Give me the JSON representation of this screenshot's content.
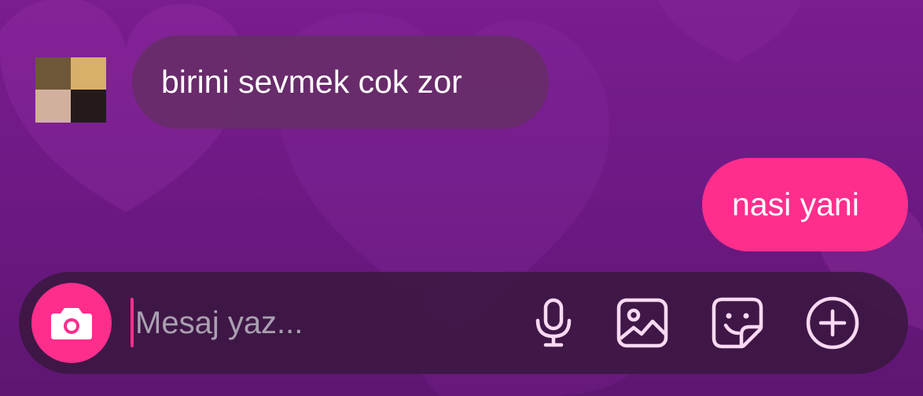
{
  "chat": {
    "messages": [
      {
        "direction": "incoming",
        "text": "birini sevmek cok zor"
      },
      {
        "direction": "outgoing",
        "text": "nasi yani"
      }
    ]
  },
  "composer": {
    "placeholder": "Mesaj yaz...",
    "value": "",
    "icons": {
      "camera": "camera-icon",
      "mic": "microphone-icon",
      "gallery": "image-gallery-icon",
      "sticker": "sticker-icon",
      "more": "plus-circle-icon"
    }
  },
  "colors": {
    "background": "#6f1985",
    "incoming_bubble": "#672d68",
    "outgoing_bubble": "#ff2e8c",
    "composer_bg": "#3a1840",
    "accent": "#ff2e8c",
    "icon_tint": "#fbd9f2"
  }
}
